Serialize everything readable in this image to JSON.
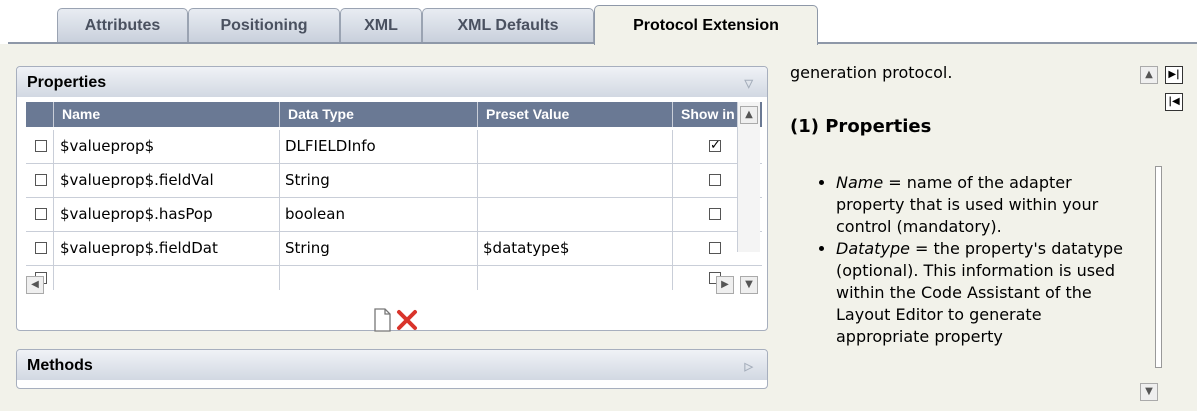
{
  "tabs": [
    {
      "label": "Attributes"
    },
    {
      "label": "Positioning"
    },
    {
      "label": "XML"
    },
    {
      "label": "XML Defaults"
    },
    {
      "label": "Protocol Extension",
      "active": true
    }
  ],
  "properties_panel": {
    "title": "Properties",
    "columns": [
      "Name",
      "Data Type",
      "Preset Value",
      "Show in"
    ],
    "rows": [
      {
        "checked": false,
        "name": "$valueprop$",
        "datatype": "DLFIELDInfo",
        "preset": "",
        "show": true
      },
      {
        "checked": false,
        "name": "$valueprop$.fieldVal",
        "datatype": "String",
        "preset": "",
        "show": false
      },
      {
        "checked": false,
        "name": "$valueprop$.hasPop",
        "datatype": "boolean",
        "preset": "",
        "show": false
      },
      {
        "checked": false,
        "name": "$valueprop$.fieldDat",
        "datatype": "String",
        "preset": "$datatype$",
        "show": false
      }
    ],
    "new_icon": "new-document-icon",
    "delete_icon": "delete-x-icon"
  },
  "methods_panel": {
    "title": "Methods"
  },
  "doc": {
    "intro": "generation protocol.",
    "heading": "(1) Properties",
    "items": [
      {
        "term": "Name",
        "text": " = name of the adapter property that is used within your control (mandatory)."
      },
      {
        "term": "Datatype",
        "text": " = the property's datatype  (optional). This information is used within the Code Assistant of the Layout Editor to generate appropriate property"
      }
    ]
  },
  "colors": {
    "header_bg": "#6a7994",
    "panel_bg": "#f2f2ea",
    "delete": "#d9342b"
  }
}
